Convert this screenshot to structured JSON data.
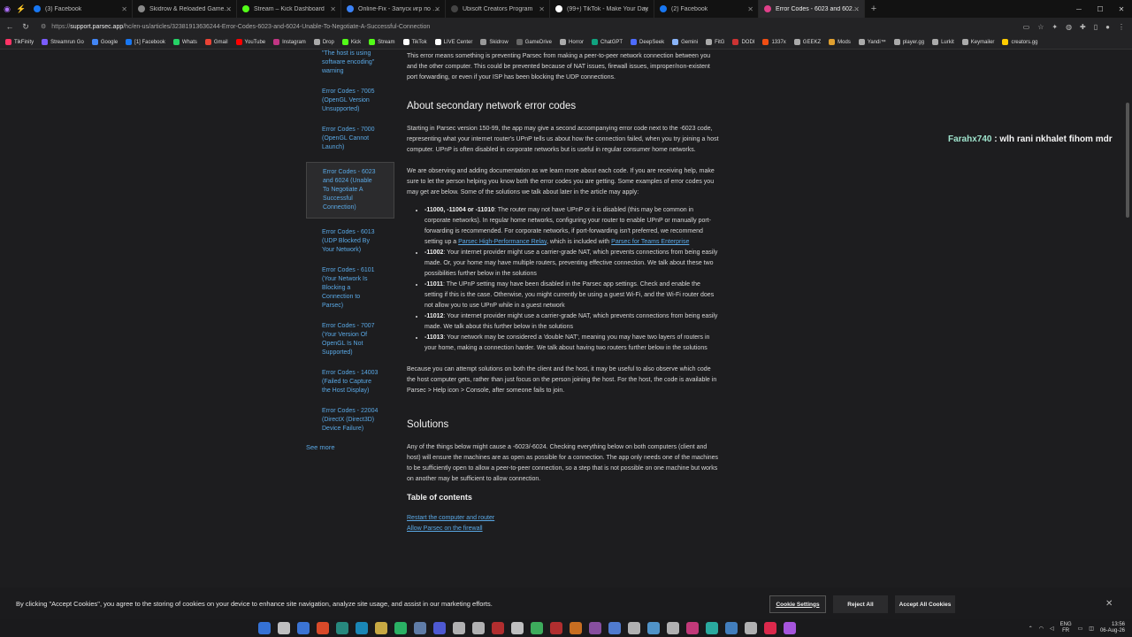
{
  "browser": {
    "tabs": [
      {
        "label": "(3) Facebook",
        "color": "#1877f2"
      },
      {
        "label": "Skidrow & Reloaded Games – Do…",
        "color": "#888888"
      },
      {
        "label": "Stream – Kick Dashboard",
        "color": "#53fc18"
      },
      {
        "label": "Online-Fix - Запуск игр по сети",
        "color": "#3b82f6"
      },
      {
        "label": "Ubisoft Creators Program",
        "color": "#444444"
      },
      {
        "label": "(99+) TikTok - Make Your Day",
        "color": "#ffffff"
      },
      {
        "label": "(2) Facebook",
        "color": "#1877f2"
      },
      {
        "label": "Error Codes - 6023 and 6024 (Una…",
        "color": "#e0408a"
      }
    ],
    "url_prefix": "https://",
    "url_host": "support.parsec.app",
    "url_path": "/hc/en-us/articles/32381913636244-Error-Codes-6023-and-6024-Unable-To-Negotiate-A-Successful-Connection",
    "bookmarks": [
      {
        "label": "TikFinity",
        "color": "#ff3366"
      },
      {
        "label": "Streamrun Go",
        "color": "#7a5cff"
      },
      {
        "label": "Google",
        "color": "#4285f4"
      },
      {
        "label": "[1] Facebook",
        "color": "#1877f2"
      },
      {
        "label": "Whats",
        "color": "#25d366"
      },
      {
        "label": "Gmail",
        "color": "#ea4335"
      },
      {
        "label": "YouTube",
        "color": "#ff0000"
      },
      {
        "label": "Instagram",
        "color": "#c13584"
      },
      {
        "label": "Drop",
        "color": "#aaaaaa"
      },
      {
        "label": "Kick",
        "color": "#53fc18"
      },
      {
        "label": "Stream",
        "color": "#53fc18"
      },
      {
        "label": "TikTok",
        "color": "#ffffff"
      },
      {
        "label": "LIVE Center",
        "color": "#ffffff"
      },
      {
        "label": "Skidrow",
        "color": "#999999"
      },
      {
        "label": "GameDrive",
        "color": "#666666"
      },
      {
        "label": "Horror",
        "color": "#aaaaaa"
      },
      {
        "label": "ChatGPT",
        "color": "#10a37f"
      },
      {
        "label": "DeepSeek",
        "color": "#4d6bfe"
      },
      {
        "label": "Gemini",
        "color": "#8ab4f8"
      },
      {
        "label": "FitG",
        "color": "#aaaaaa"
      },
      {
        "label": "DODI",
        "color": "#cc3333"
      },
      {
        "label": "1337x",
        "color": "#f14e13"
      },
      {
        "label": "GEEKZ",
        "color": "#aaaaaa"
      },
      {
        "label": "Mods",
        "color": "#e0a030"
      },
      {
        "label": "Yandi™",
        "color": "#aaaaaa"
      },
      {
        "label": "player.gg",
        "color": "#aaaaaa"
      },
      {
        "label": "Lurkit",
        "color": "#aaaaaa"
      },
      {
        "label": "Keymailer",
        "color": "#aaaaaa"
      },
      {
        "label": "creators.gg",
        "color": "#ffcc00"
      }
    ]
  },
  "sidebar": {
    "items": [
      {
        "label": "\"The host is using software encoding\" warning",
        "active": false
      },
      {
        "label": "Error Codes - 7005 (OpenGL Version Unsupported)",
        "active": false
      },
      {
        "label": "Error Codes - 7000 (OpenGL Cannot Launch)",
        "active": false
      },
      {
        "label": "Error Codes - 6023 and 6024 (Unable To Negotiate A Successful Connection)",
        "active": true
      },
      {
        "label": "Error Codes - 6013 (UDP Blocked By Your Network)",
        "active": false
      },
      {
        "label": "Error Codes - 6101 (Your Network Is Blocking a Connection to Parsec)",
        "active": false
      },
      {
        "label": "Error Codes - 7007 (Your Version Of OpenGL Is Not Supported)",
        "active": false
      },
      {
        "label": "Error Codes - 14003 (Failed to Capture the Host Display)",
        "active": false
      },
      {
        "label": "Error Codes - 22004 (DirectX (Direct3D) Device Failure)",
        "active": false
      }
    ],
    "see_more": "See more"
  },
  "article": {
    "intro": "This error means something is preventing Parsec from making a peer-to-peer network connection between you and the other computer. This could be prevented because of NAT issues, firewall issues, improper/non-existent port forwarding, or even if your ISP has been blocking the UDP connections.",
    "h_secondary": "About secondary network error codes",
    "p_secondary1": "Starting in Parsec version 150-99, the app may give a second accompanying error code next to the -6023 code, representing what your internet router's UPnP tells us about how the connection failed, when you try joining a host computer. UPnP is often disabled in corporate networks but is useful in regular consumer home networks.",
    "p_secondary2": "We are observing and adding documentation as we learn more about each code. If you are receiving help, make sure to let the person helping you know both the error codes you are getting. Some examples of error codes you may get are below. Some of the solutions we talk about later in the article may apply:",
    "li1_code": "-11000, -11004 or -11010",
    "li1_text1": ": The router may not have UPnP or it is disabled (this may be common in corporate networks). In regular home networks, configuring your router to enable UPnP or manually port-forwarding is recommended. For corporate networks, if port-forwarding isn't preferred, we recommend setting up a ",
    "li1_link1": "Parsec High-Performance Relay",
    "li1_text2": ", which is included with ",
    "li1_link2": "Parsec for Teams Enterprise",
    "li2_code": "-11002",
    "li2_text": ": Your internet provider might use a carrier-grade NAT, which prevents connections from being easily made. Or, your home may have multiple routers, preventing effective connection. We talk about these two possibilities further below in the solutions",
    "li3_code": "-11011",
    "li3_text": ": The UPnP setting may have been disabled in the Parsec app settings. Check and enable the setting if this is the case. Otherwise, you might currently be using a guest Wi-Fi, and the Wi-Fi router does not allow you to use UPnP while in a guest network",
    "li4_code": "-11012",
    "li4_text": ": Your internet provider might use a carrier-grade NAT, which prevents connections from being easily made. We talk about this further below in the solutions",
    "li5_code": "-11013",
    "li5_text": ": Your network may be considered a 'double NAT', meaning you may have two layers of routers in your home, making a connection harder. We talk about having two routers further below in the solutions",
    "p_observe": "Because you can attempt solutions on both the client and the host, it may be useful to also observe which code the host computer gets, rather than just focus on the person joining the host. For the host, the code is available in Parsec > Help icon > Console, after someone fails to join.",
    "h_solutions": "Solutions",
    "p_solutions": "Any of the things below might cause a -6023/-6024. Checking everything below on both computers (client and host) will ensure the machines are as open as possible for a connection. The app only needs one of the machines to be sufficiently open to allow a peer-to-peer connection, so a step that is not possible on one machine but works on another may be sufficient to allow connection.",
    "h_toc": "Table of contents",
    "toc": [
      "Restart the computer and router",
      "Allow Parsec on the firewall"
    ]
  },
  "overlay": {
    "user": "Farahx740",
    "message": " : wlh rani nkhalet fihom mdr"
  },
  "cookie": {
    "text": "By clicking \"Accept Cookies\", you agree to the storing of cookies on your device to enhance site navigation, analyze site usage, and assist in our marketing efforts.",
    "settings": "Cookie Settings",
    "reject": "Reject All",
    "accept": "Accept All Cookies"
  },
  "taskbar": {
    "lang1": "ENG",
    "lang2": "FR",
    "time": "13:56",
    "date": "06-Aug-26"
  }
}
